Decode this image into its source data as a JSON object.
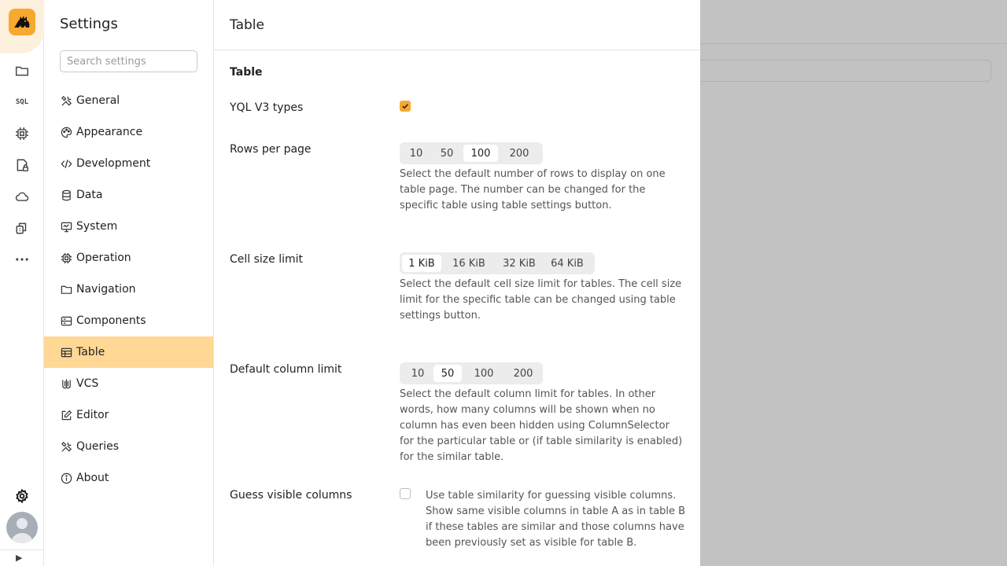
{
  "rail": {
    "items": [
      {
        "icon": "folder-icon"
      },
      {
        "icon": "sql-icon",
        "label": "SQL"
      },
      {
        "icon": "chip-icon"
      },
      {
        "icon": "lock-file-icon"
      },
      {
        "icon": "cloud-icon"
      },
      {
        "icon": "apps-icon"
      },
      {
        "icon": "more-icon"
      }
    ],
    "collapse_glyph": "▶"
  },
  "settings": {
    "title": "Settings",
    "search_placeholder": "Search settings",
    "items": [
      {
        "label": "General",
        "icon": "tools-icon",
        "active": false
      },
      {
        "label": "Appearance",
        "icon": "palette-icon",
        "active": false
      },
      {
        "label": "Development",
        "icon": "code-icon",
        "active": false
      },
      {
        "label": "Data",
        "icon": "database-icon",
        "active": false
      },
      {
        "label": "System",
        "icon": "monitor-icon",
        "active": false
      },
      {
        "label": "Operation",
        "icon": "chip-icon",
        "active": false
      },
      {
        "label": "Navigation",
        "icon": "folder-icon",
        "active": false
      },
      {
        "label": "Components",
        "icon": "server-icon",
        "active": false
      },
      {
        "label": "Table",
        "icon": "table-icon",
        "active": true
      },
      {
        "label": "VCS",
        "icon": "vcs-icon",
        "active": false
      },
      {
        "label": "Editor",
        "icon": "edit-icon",
        "active": false
      },
      {
        "label": "Queries",
        "icon": "tools-icon",
        "active": false
      },
      {
        "label": "About",
        "icon": "info-icon",
        "active": false
      }
    ]
  },
  "panel": {
    "header": "Table",
    "section_title": "Table",
    "yql_v3": {
      "label": "YQL V3 types",
      "checked": true
    },
    "rows_per_page": {
      "label": "Rows per page",
      "options": [
        "10",
        "50",
        "100",
        "200"
      ],
      "selected": "100",
      "description": "Select the default number of rows to display on one table page. The number can be changed for the specific table using table settings button."
    },
    "cell_size_limit": {
      "label": "Cell size limit",
      "options": [
        "1 KiB",
        "16 KiB",
        "32 KiB",
        "64 KiB"
      ],
      "selected": "1 KiB",
      "description": "Select the default cell size limit for tables. The cell size limit for the specific table can be changed using table settings button."
    },
    "default_column_limit": {
      "label": "Default column limit",
      "options": [
        "10",
        "50",
        "100",
        "200"
      ],
      "selected": "50",
      "description": "Select the default column limit for tables. In other words, how many columns will be shown when no column has even been hidden using ColumnSelector for the particular table or (if table similarity is enabled) for the similar table."
    },
    "guess_visible_columns": {
      "label": "Guess visible columns",
      "checked": false,
      "description": "Use table similarity for guessing visible columns. Show same visible columns in table A as in table B if these tables are similar and those columns have been previously set as visible for table B."
    }
  },
  "colors": {
    "accent": "#f7a82f",
    "active_nav": "#ffd896",
    "overlay": "#c2c2c2"
  }
}
